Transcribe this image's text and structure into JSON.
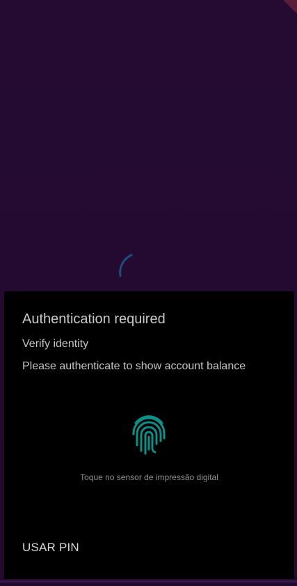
{
  "dialog": {
    "title": "Authentication required",
    "subtitle": "Verify identity",
    "description": "Please authenticate to show account balance",
    "fingerprint_icon": "fingerprint-icon",
    "hint": "Toque no sensor de impressão digital",
    "pin_button_label": "USAR PIN"
  },
  "colors": {
    "background": "#220a2e",
    "sheet": "#000000",
    "fingerprint": "#0e8f88",
    "spinner": "#1b4f7a"
  }
}
